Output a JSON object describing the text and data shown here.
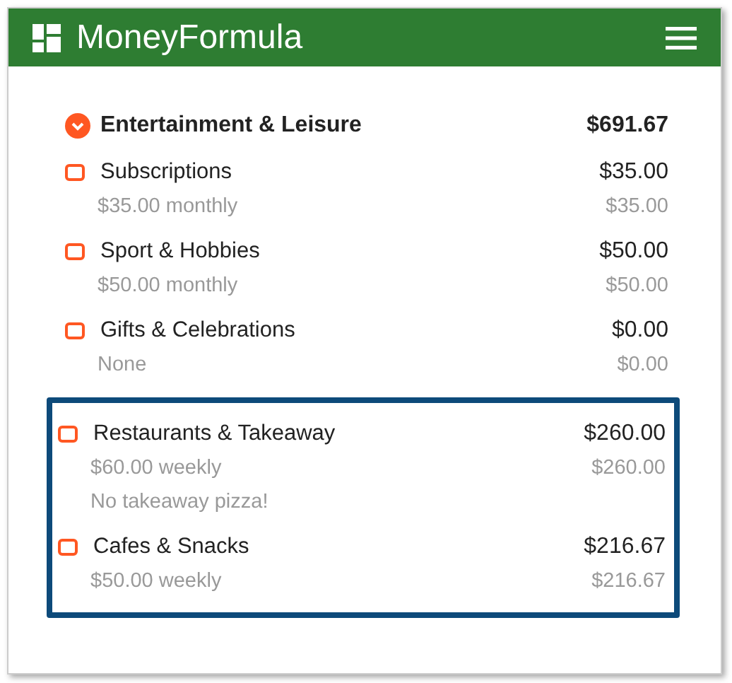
{
  "app": {
    "title": "MoneyFormula"
  },
  "category": {
    "name": "Entertainment & Leisure",
    "total": "$691.67",
    "expanded": true
  },
  "items": [
    {
      "name": "Subscriptions",
      "amount": "$35.00",
      "schedule": "$35.00 monthly",
      "sub_amount": "$35.00",
      "highlighted": false
    },
    {
      "name": "Sport & Hobbies",
      "amount": "$50.00",
      "schedule": "$50.00 monthly",
      "sub_amount": "$50.00",
      "highlighted": false
    },
    {
      "name": "Gifts & Celebrations",
      "amount": "$0.00",
      "schedule": "None",
      "sub_amount": "$0.00",
      "highlighted": false
    },
    {
      "name": "Restaurants & Takeaway",
      "amount": "$260.00",
      "schedule": "$60.00 weekly",
      "sub_amount": "$260.00",
      "note": "No takeaway pizza!",
      "highlighted": true
    },
    {
      "name": "Cafes & Snacks",
      "amount": "$216.67",
      "schedule": "$50.00 weekly",
      "sub_amount": "$216.67",
      "highlighted": true
    }
  ]
}
